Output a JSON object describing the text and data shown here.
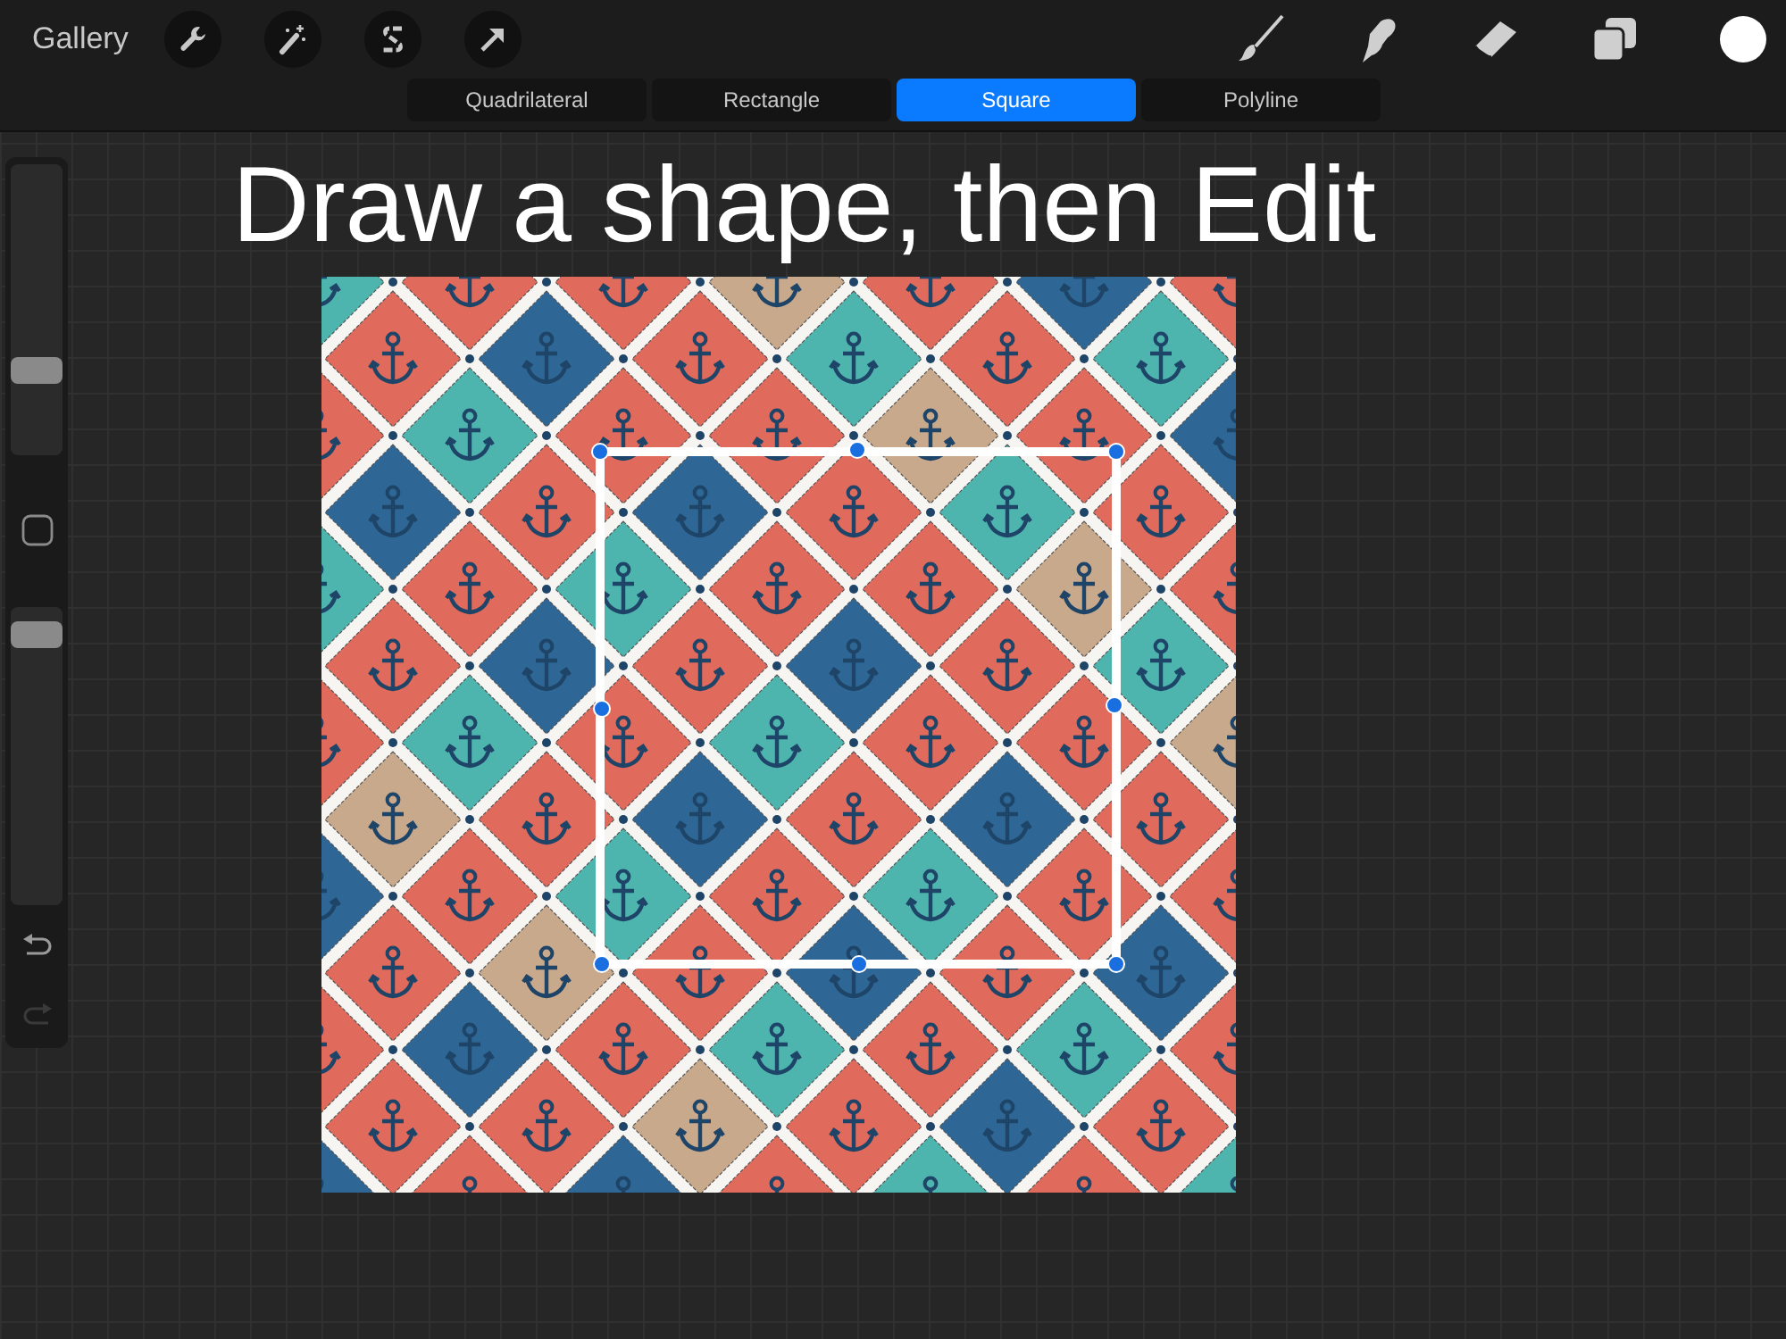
{
  "toolbar": {
    "gallery_label": "Gallery"
  },
  "shape_modes": [
    {
      "label": "Quadrilateral",
      "selected": false
    },
    {
      "label": "Rectangle",
      "selected": false
    },
    {
      "label": "Square",
      "selected": true
    },
    {
      "label": "Polyline",
      "selected": false
    }
  ],
  "instruction": "Draw a shape, then Edit",
  "sidebar": {
    "brush_size": {
      "level": 0.27
    },
    "opacity": {
      "level": 0.95
    }
  }
}
